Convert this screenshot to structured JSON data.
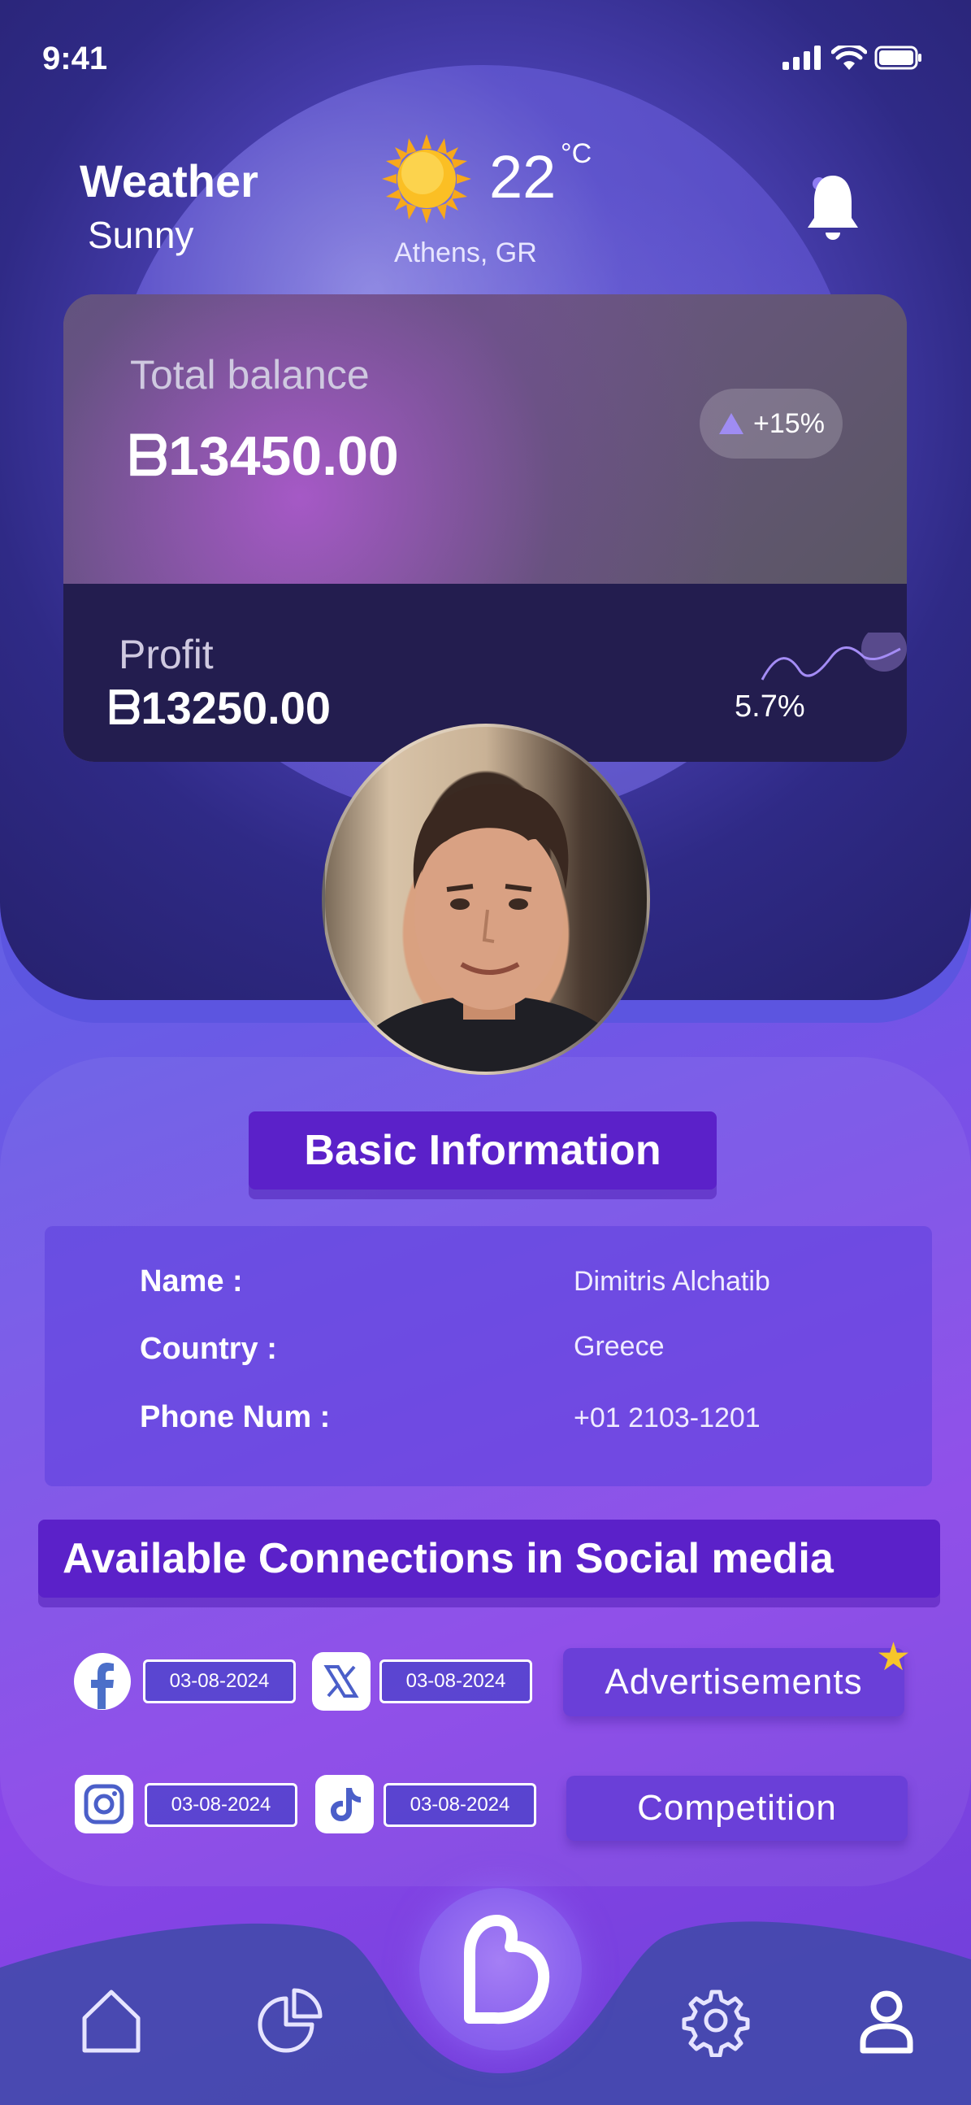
{
  "status_bar": {
    "time": "9:41"
  },
  "weather": {
    "title": "Weather",
    "condition": "Sunny",
    "temperature": "22",
    "unit": "°C",
    "location": "Athens, GR"
  },
  "balance": {
    "label": "Total balance",
    "value": "ᗷ13450.00",
    "change": "+15%"
  },
  "profit": {
    "label": "Profit",
    "value": "ᗷ13250.00",
    "percent": "5.7%"
  },
  "basic_info": {
    "title": "Basic Information",
    "rows": [
      {
        "label": "Name :",
        "value": "Dimitris Alchatib"
      },
      {
        "label": "Country :",
        "value": "Greece"
      },
      {
        "label": "Phone Num :",
        "value": "+01 2103-1201"
      }
    ]
  },
  "social": {
    "title": "Available Connections in Social media",
    "items": [
      {
        "icon": "facebook-icon",
        "date": "03-08-2024"
      },
      {
        "icon": "x-icon",
        "date": "03-08-2024"
      },
      {
        "icon": "instagram-icon",
        "date": "03-08-2024"
      },
      {
        "icon": "tiktok-icon",
        "date": "03-08-2024"
      }
    ],
    "buttons": {
      "advertisements": "Advertisements",
      "competition": "Competition"
    }
  },
  "colors": {
    "accent": "#5b21c9",
    "star": "#f7c52a",
    "card_dark": "#231d4f"
  },
  "nav": [
    "home-icon",
    "pie-chart-icon",
    "brand-logo-icon",
    "gear-icon",
    "profile-icon"
  ]
}
